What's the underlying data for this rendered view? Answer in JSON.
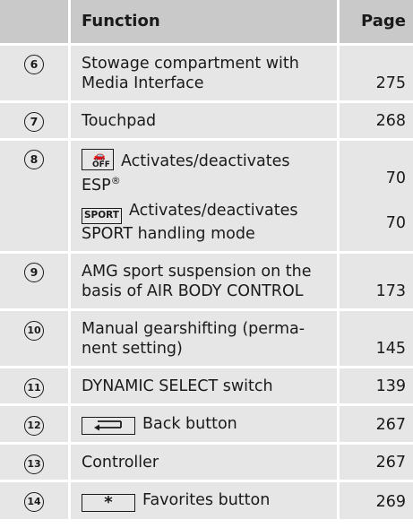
{
  "header": {
    "function_label": "Function",
    "page_label": "Page"
  },
  "rows": [
    {
      "num": "6",
      "line1": "Stowage compartment with",
      "line2": "Media Interface",
      "page": "275"
    },
    {
      "num": "7",
      "text": "Touchpad",
      "page": "268"
    },
    {
      "num": "8",
      "esp_key": "OFF",
      "esp_line1": "Activates/deactivates",
      "esp_line2": "ESP",
      "esp_sup": "®",
      "esp_page": "70",
      "sport_key": "SPORT",
      "sport_line1": "Activates/deactivates",
      "sport_line2": "SPORT handling mode",
      "sport_page": "70"
    },
    {
      "num": "9",
      "line1": "AMG sport suspension on the",
      "line2": "basis of AIR BODY CONTROL",
      "page": "173"
    },
    {
      "num": "10",
      "line1": "Manual gearshifting (perma-",
      "line2": "nent setting)",
      "page": "145"
    },
    {
      "num": "11",
      "text": "DYNAMIC SELECT switch",
      "page": "139"
    },
    {
      "num": "12",
      "key_icon": "back-arrow-icon",
      "text": "Back button",
      "page": "267"
    },
    {
      "num": "13",
      "text": "Controller",
      "page": "267"
    },
    {
      "num": "14",
      "key_icon": "star-icon",
      "key_text": "*",
      "text": "Favorites button",
      "page": "269"
    }
  ]
}
